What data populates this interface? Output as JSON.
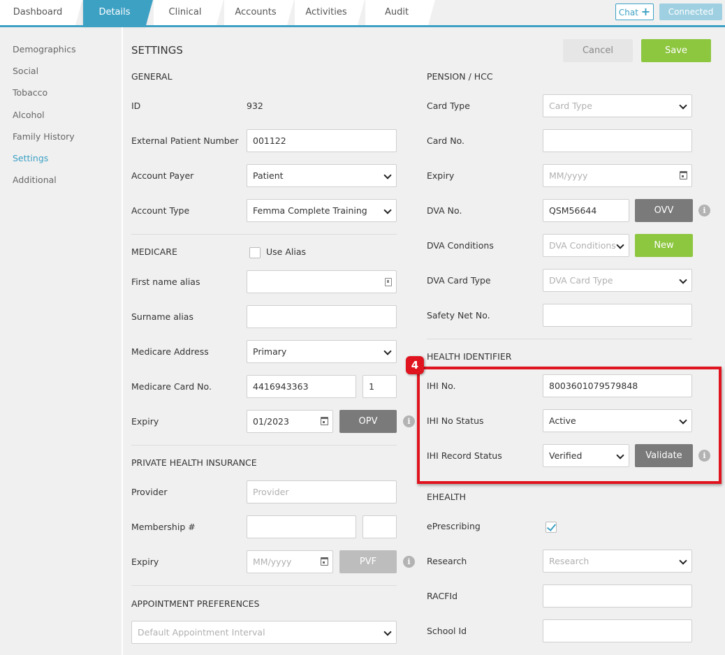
{
  "tabs": [
    {
      "label": "Dashboard"
    },
    {
      "label": "Details"
    },
    {
      "label": "Clinical"
    },
    {
      "label": "Accounts"
    },
    {
      "label": "Activities"
    },
    {
      "label": "Audit"
    }
  ],
  "header": {
    "chat_label": "Chat",
    "connected_label": "Connected"
  },
  "sidebar": {
    "items": [
      {
        "label": "Demographics"
      },
      {
        "label": "Social"
      },
      {
        "label": "Tobacco"
      },
      {
        "label": "Alcohol"
      },
      {
        "label": "Family History"
      },
      {
        "label": "Settings"
      },
      {
        "label": "Additional"
      }
    ]
  },
  "page": {
    "title": "SETTINGS",
    "cancel_label": "Cancel",
    "save_label": "Save"
  },
  "general": {
    "heading": "GENERAL",
    "id_label": "ID",
    "id_value": "932",
    "external_label": "External Patient Number",
    "external_value": "001122",
    "payer_label": "Account Payer",
    "payer_value": "Patient",
    "type_label": "Account Type",
    "type_value": "Femma Complete Training"
  },
  "medicare": {
    "heading": "MEDICARE",
    "use_alias_label": "Use Alias",
    "first_alias_label": "First name alias",
    "surname_alias_label": "Surname alias",
    "address_label": "Medicare Address",
    "address_value": "Primary",
    "card_label": "Medicare Card No.",
    "card_value": "4416943363",
    "card_irn": "1",
    "expiry_label": "Expiry",
    "expiry_value": "01/2023",
    "opv_label": "OPV"
  },
  "phi": {
    "heading": "PRIVATE HEALTH INSURANCE",
    "provider_label": "Provider",
    "provider_placeholder": "Provider",
    "membership_label": "Membership #",
    "expiry_label": "Expiry",
    "expiry_placeholder": "MM/yyyy",
    "pvf_label": "PVF"
  },
  "appointment": {
    "heading": "APPOINTMENT PREFERENCES",
    "interval_placeholder": "Default Appointment Interval"
  },
  "pension": {
    "heading": "PENSION / HCC",
    "card_type_label": "Card Type",
    "card_type_placeholder": "Card Type",
    "card_no_label": "Card No.",
    "expiry_label": "Expiry",
    "expiry_placeholder": "MM/yyyy",
    "dva_no_label": "DVA No.",
    "dva_no_value": "QSM56644",
    "ovv_label": "OVV",
    "dva_conditions_label": "DVA Conditions",
    "dva_conditions_placeholder": "DVA Conditions",
    "new_label": "New",
    "dva_card_type_label": "DVA Card Type",
    "dva_card_type_placeholder": "DVA Card Type",
    "safety_net_label": "Safety Net No."
  },
  "health_identifier": {
    "heading": "HEALTH IDENTIFIER",
    "step_number": "4",
    "ihi_no_label": "IHI No.",
    "ihi_no_value": "8003601079579848",
    "ihi_status_label": "IHI No Status",
    "ihi_status_value": "Active",
    "ihi_record_label": "IHI Record Status",
    "ihi_record_value": "Verified",
    "validate_label": "Validate"
  },
  "ehealth": {
    "heading": "EHEALTH",
    "eprescribing_label": "ePrescribing",
    "research_label": "Research",
    "research_placeholder": "Research",
    "racfid_label": "RACFId",
    "school_label": "School Id"
  },
  "info_glyph": "i",
  "colors": {
    "accent": "#3da1c4",
    "save": "#8dc63f",
    "highlight": "#e0141e"
  }
}
